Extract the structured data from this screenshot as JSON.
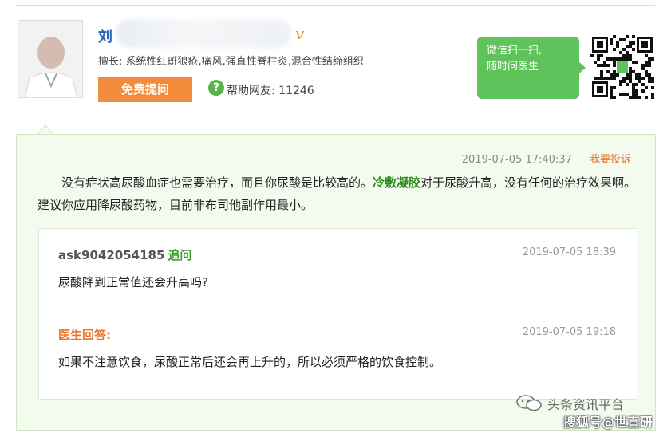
{
  "doctor": {
    "name_visible": "刘",
    "verified_mark": "v",
    "specialty": "擅长: 系统性红斑狼疮,痛风,强直性脊柱炎,混合性结缔组织",
    "ask_button": "免费提问",
    "help_label": "帮助网友: 11246"
  },
  "wechat": {
    "line1": "微信扫一扫,",
    "line2": "随时问医生"
  },
  "answer": {
    "time": "2019-07-05 17:40:37",
    "report": "我要投诉",
    "text_before": "没有症状高尿酸血症也需要治疗，而且你尿酸是比较高的。",
    "drug": "冷敷凝胶",
    "text_after": "对于尿酸升高，没有任何的治疗效果啊。建议你应用降尿酸药物，目前非布司他副作用最小。"
  },
  "followup": {
    "user": "ask9042054185",
    "tag": "追问",
    "time": "2019-07-05 18:39",
    "question": "尿酸降到正常值还会升高吗?"
  },
  "reply": {
    "label": "医生回答:",
    "time": "2019-07-05 19:18",
    "text": "如果不注意饮食，尿酸正常后还会再上升的，所以必须严格的饮食控制。"
  },
  "watermark": {
    "line1": "头条资讯平台",
    "line2": "搜狐号@世直研"
  },
  "colors": {
    "accent_green": "#5fc25a",
    "orange": "#f28c3c",
    "link_blue": "#2a62b5"
  }
}
